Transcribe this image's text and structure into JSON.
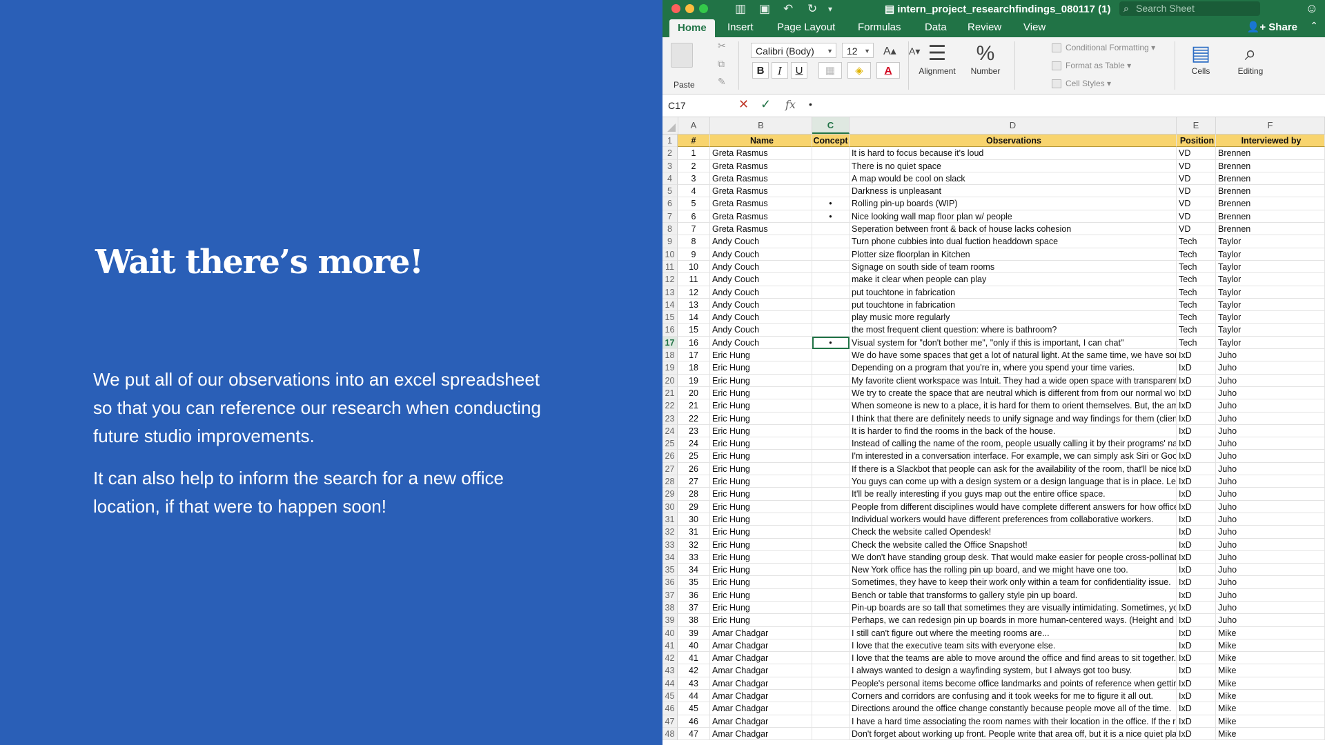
{
  "slide": {
    "heading": "Wait there’s more!",
    "paragraph1": "We put all of our observations into an excel spreadsheet so that you can reference our research when conducting future studio improvements.",
    "paragraph2": "It can also help to inform the search for a new office location, if that were to happen soon!"
  },
  "excel": {
    "title": "intern_project_researchfindings_080117 (1)",
    "search_placeholder": "Search Sheet",
    "tabs": [
      "Home",
      "Insert",
      "Page Layout",
      "Formulas",
      "Data",
      "Review",
      "View"
    ],
    "share_label": "Share",
    "ribbon": {
      "paste": "Paste",
      "font_name": "Calibri (Body)",
      "font_size": "12",
      "bold": "B",
      "italic": "I",
      "underline": "U",
      "alignment": "Alignment",
      "number": "Number",
      "conditional_formatting": "Conditional Formatting",
      "format_as_table": "Format as Table",
      "cell_styles": "Cell Styles",
      "cells": "Cells",
      "editing": "Editing"
    },
    "formula_bar": {
      "cell_ref": "C17",
      "fx": "fx",
      "content": "•"
    },
    "column_letters": [
      "A",
      "B",
      "C",
      "D",
      "E",
      "F"
    ],
    "selected_column": "C",
    "selected_row": 17,
    "header_row": [
      "#",
      "Name",
      "Concept",
      "Observations",
      "Position",
      "Interviewed by"
    ],
    "rows": [
      [
        "1",
        "Greta Rasmus",
        "",
        "It is hard to focus because it's loud",
        "VD",
        "Brennen"
      ],
      [
        "2",
        "Greta Rasmus",
        "",
        "There is no quiet space",
        "VD",
        "Brennen"
      ],
      [
        "3",
        "Greta Rasmus",
        "",
        "A map would be cool on slack",
        "VD",
        "Brennen"
      ],
      [
        "4",
        "Greta Rasmus",
        "",
        "Darkness is unpleasant",
        "VD",
        "Brennen"
      ],
      [
        "5",
        "Greta Rasmus",
        "•",
        "Rolling pin-up boards (WIP)",
        "VD",
        "Brennen"
      ],
      [
        "6",
        "Greta Rasmus",
        "•",
        "Nice looking wall map floor plan w/ people",
        "VD",
        "Brennen"
      ],
      [
        "7",
        "Greta Rasmus",
        "",
        "Seperation between front & back of house lacks cohesion",
        "VD",
        "Brennen"
      ],
      [
        "8",
        "Andy Couch",
        "",
        "Turn phone cubbies into dual fuction headdown space",
        "Tech",
        "Taylor"
      ],
      [
        "9",
        "Andy Couch",
        "",
        "Plotter size floorplan in Kitchen",
        "Tech",
        "Taylor"
      ],
      [
        "10",
        "Andy Couch",
        "",
        "Signage on south side of team rooms",
        "Tech",
        "Taylor"
      ],
      [
        "11",
        "Andy Couch",
        "",
        "make it clear when people can play",
        "Tech",
        "Taylor"
      ],
      [
        "12",
        "Andy Couch",
        "",
        "put touchtone in fabrication",
        "Tech",
        "Taylor"
      ],
      [
        "13",
        "Andy Couch",
        "",
        "put touchtone in fabrication",
        "Tech",
        "Taylor"
      ],
      [
        "14",
        "Andy Couch",
        "",
        "play music more regularly",
        "Tech",
        "Taylor"
      ],
      [
        "15",
        "Andy Couch",
        "",
        "the most frequent client question: where is bathroom?",
        "Tech",
        "Taylor"
      ],
      [
        "16",
        "Andy Couch",
        "•",
        "Visual system for \"don't bother me\", \"only if this is important, I can chat\"",
        "Tech",
        "Taylor"
      ],
      [
        "17",
        "Eric Hung",
        "",
        "We do have some spaces that get a lot of natural light. At the same time, we have some spaces that are",
        "IxD",
        "Juho"
      ],
      [
        "18",
        "Eric Hung",
        "",
        "Depending on a program that you're in, where you spend your time varies.",
        "IxD",
        "Juho"
      ],
      [
        "19",
        "Eric Hung",
        "",
        "My favorite client workspace was Intuit. They had a wide open space with transparent window that bec",
        "IxD",
        "Juho"
      ],
      [
        "20",
        "Eric Hung",
        "",
        "We try to create the space that are neutral which is different from from our normal working area. We w",
        "IxD",
        "Juho"
      ],
      [
        "21",
        "Eric Hung",
        "",
        "When someone is new to a place, it is hard for them to orient themselves. But, the amount of time that",
        "IxD",
        "Juho"
      ],
      [
        "22",
        "Eric Hung",
        "",
        "I think that there are definitely needs to unify signage and way findings for them (clients), but then how",
        "IxD",
        "Juho"
      ],
      [
        "23",
        "Eric Hung",
        "",
        "It is harder to find the rooms in the back of the house.",
        "IxD",
        "Juho"
      ],
      [
        "24",
        "Eric Hung",
        "",
        "Instead of calling the name of the room, people usually calling it by their programs' name. Except for th",
        "IxD",
        "Juho"
      ],
      [
        "25",
        "Eric Hung",
        "",
        "I'm interested in a conversation interface. For example, we can simply ask Siri or Google whether the ro",
        "IxD",
        "Juho"
      ],
      [
        "26",
        "Eric Hung",
        "",
        "If there is a Slackbot that people can ask for the availability of the room, that'll be nice.",
        "IxD",
        "Juho"
      ],
      [
        "27",
        "Eric Hung",
        "",
        "You guys can come up with a design system or a design language that is in place. Let's say that the goal i",
        "IxD",
        "Juho"
      ],
      [
        "28",
        "Eric Hung",
        "",
        "It'll be really interesting if you guys map out the entire office space.",
        "IxD",
        "Juho"
      ],
      [
        "29",
        "Eric Hung",
        "",
        "People from different disciplines would have complete different answers for how office space should be",
        "IxD",
        "Juho"
      ],
      [
        "30",
        "Eric Hung",
        "",
        "Individual workers would have different preferences from collaborative workers.",
        "IxD",
        "Juho"
      ],
      [
        "31",
        "Eric Hung",
        "",
        "Check the website called Opendesk!",
        "IxD",
        "Juho"
      ],
      [
        "32",
        "Eric Hung",
        "",
        "Check the website called the Office Snapshot!",
        "IxD",
        "Juho"
      ],
      [
        "33",
        "Eric Hung",
        "",
        "We don't have standing group desk. That would make easier for people cross-pollinate the ideas, sharin",
        "IxD",
        "Juho"
      ],
      [
        "34",
        "Eric Hung",
        "",
        "New York office has the rolling pin up board, and we might have one too.",
        "IxD",
        "Juho"
      ],
      [
        "35",
        "Eric Hung",
        "",
        "Sometimes, they have to keep their work only within a team for confidentiality issue.",
        "IxD",
        "Juho"
      ],
      [
        "36",
        "Eric Hung",
        "",
        "Bench or table that transforms to gallery style pin up board.",
        "IxD",
        "Juho"
      ],
      [
        "37",
        "Eric Hung",
        "",
        "Pin-up boards are so tall that sometimes they are visually intimidating. Sometimes, you can't even see a",
        "IxD",
        "Juho"
      ],
      [
        "38",
        "Eric Hung",
        "",
        "Perhaps, we can redesign pin up boards in more human-centered ways. (Height and eye level, etc.) Wha",
        "IxD",
        "Juho"
      ],
      [
        "39",
        "Amar Chadgar",
        "",
        "I still can't figure out where the meeting rooms are...",
        "IxD",
        "Mike"
      ],
      [
        "40",
        "Amar Chadgar",
        "",
        "I love that the executive team sits with everyone else.",
        "IxD",
        "Mike"
      ],
      [
        "41",
        "Amar Chadgar",
        "",
        "I love that the teams are able to move around the office and find areas to sit together.",
        "IxD",
        "Mike"
      ],
      [
        "42",
        "Amar Chadgar",
        "",
        "I always wanted to design a wayfinding system, but I always got too busy.",
        "IxD",
        "Mike"
      ],
      [
        "43",
        "Amar Chadgar",
        "",
        "People's personal items become office landmarks and points of reference when getting around. (iron m",
        "IxD",
        "Mike"
      ],
      [
        "44",
        "Amar Chadgar",
        "",
        "Corners and corridors are confusing and it took weeks for me to figure it all out.",
        "IxD",
        "Mike"
      ],
      [
        "45",
        "Amar Chadgar",
        "",
        "Directions around the office change constantly because people move all of the time.",
        "IxD",
        "Mike"
      ],
      [
        "46",
        "Amar Chadgar",
        "",
        "I have a hard time associating the room names with their location in the office. If the room names had s",
        "IxD",
        "Mike"
      ],
      [
        "47",
        "Amar Chadgar",
        "",
        "Don't forget about working up front. People write that area off, but it is a nice quiet place to work.",
        "IxD",
        "Mike"
      ]
    ]
  }
}
